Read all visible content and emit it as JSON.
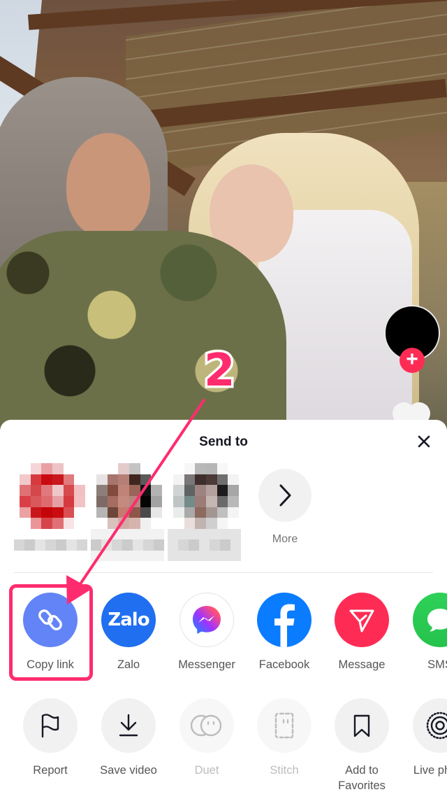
{
  "video": {
    "creator_avatar": "avatar-circle",
    "follow_icon": "plus-icon"
  },
  "annotation": {
    "step_number": "2",
    "accent": "#fe2c6e"
  },
  "share_sheet": {
    "title": "Send to",
    "close_icon": "close-icon",
    "contacts": [
      {
        "name": "pixelated-contact-1"
      },
      {
        "name": "pixelated-contact-2"
      },
      {
        "name": "pixelated-contact-3"
      }
    ],
    "more_label": "More",
    "share_targets": [
      {
        "id": "copy-link",
        "label": "Copy link",
        "color": "#6384f6",
        "icon": "link-icon"
      },
      {
        "id": "zalo",
        "label": "Zalo",
        "color": "#1f6ff0",
        "icon": "zalo-logo",
        "logo_text": "Zalo"
      },
      {
        "id": "messenger",
        "label": "Messenger",
        "color": "#ffffff",
        "icon": "messenger-icon"
      },
      {
        "id": "facebook",
        "label": "Facebook",
        "color": "#0a7cff",
        "icon": "facebook-icon"
      },
      {
        "id": "message",
        "label": "Message",
        "color": "#fe2c55",
        "icon": "send-icon"
      },
      {
        "id": "sms",
        "label": "SMS",
        "color": "#2fd158",
        "icon": "sms-icon"
      }
    ],
    "actions": [
      {
        "id": "report",
        "label": "Report",
        "icon": "flag-icon",
        "disabled": false
      },
      {
        "id": "save-video",
        "label": "Save video",
        "icon": "download-icon",
        "disabled": false
      },
      {
        "id": "duet",
        "label": "Duet",
        "icon": "duet-icon",
        "disabled": true
      },
      {
        "id": "stitch",
        "label": "Stitch",
        "icon": "stitch-icon",
        "disabled": true
      },
      {
        "id": "add-to-favorites",
        "label": "Add to\nFavorites",
        "label_line1": "Add to",
        "label_line2": "Favorites",
        "icon": "bookmark-icon",
        "disabled": false
      },
      {
        "id": "live-photo",
        "label": "Live photo",
        "icon": "live-photo-icon",
        "disabled": false
      }
    ]
  }
}
